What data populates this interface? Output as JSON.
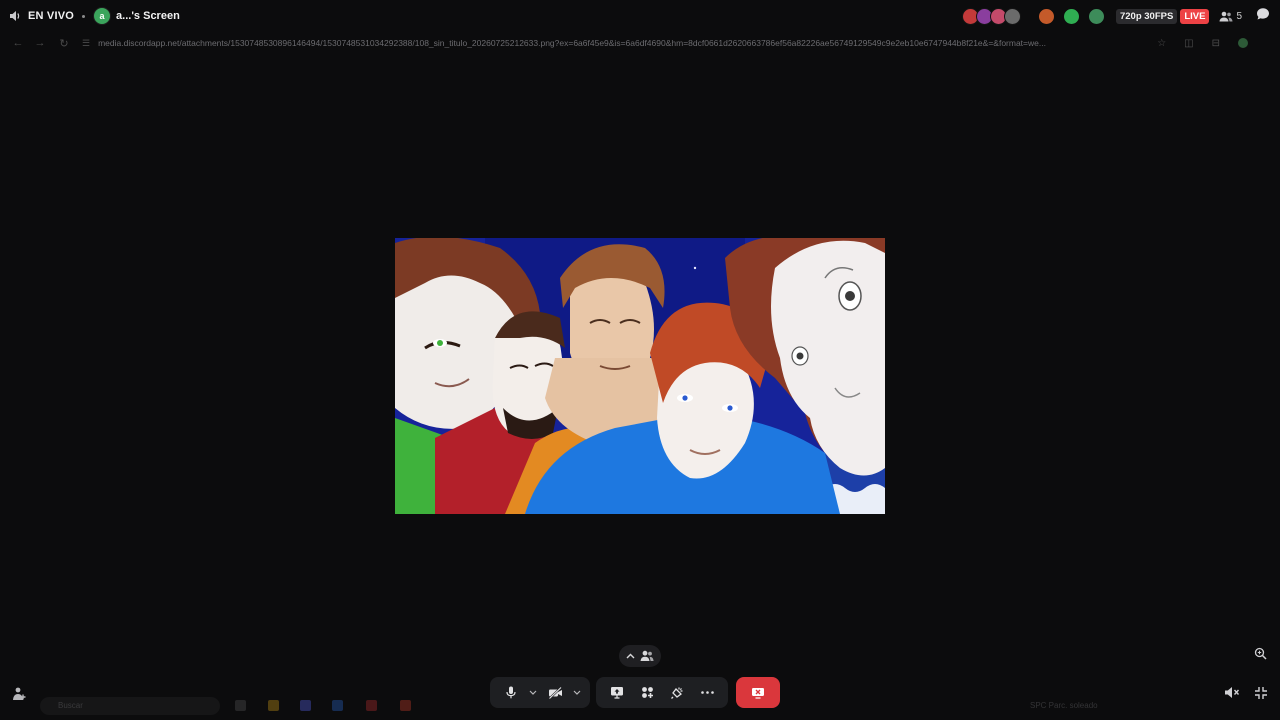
{
  "stream": {
    "live_label": "EN VIVO",
    "title": "a...'s Screen",
    "streamer_initial": "a"
  },
  "badges": {
    "quality": "720p 30FPS",
    "live": "LIVE",
    "viewer_count": "5"
  },
  "browser": {
    "url": "media.discordapp.net/attachments/1530748530896146494/1530748531034292388/108_sin_titulo_20260725212633.png?ex=6a6f45e9&is=6a6df4690&hm=8dcf0661d2620663786ef56a82226ae56749129549c9e2eb10e6747944b8f21e&=&format=we..."
  },
  "taskbar": {
    "search_placeholder": "Buscar",
    "status_text": "SPC  Parc. soleado"
  },
  "colors": {
    "live_red": "#ed4245",
    "disconnect_red": "#da373c",
    "control_bg": "#1e1f22",
    "background": "#0c0c0d"
  },
  "icons": {
    "speaker": "speaker-icon",
    "viewers": "people-icon",
    "chat": "chat-bubble-icon",
    "mic": "microphone-icon",
    "camera": "camera-off-icon",
    "screenshare": "screen-share-icon",
    "activities": "activities-icon",
    "soundboard": "soundboard-icon",
    "more": "more-icon",
    "disconnect": "stop-stream-icon",
    "zoom": "zoom-icon",
    "fullscreen": "fullscreen-exit-icon"
  }
}
